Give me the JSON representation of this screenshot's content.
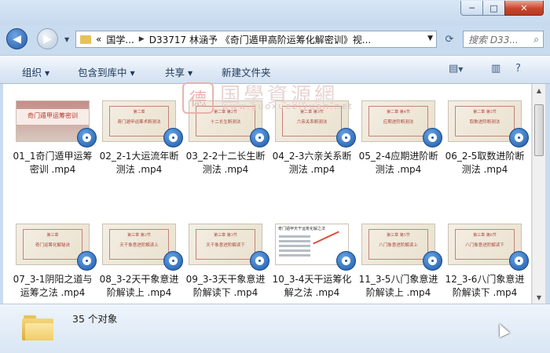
{
  "window": {
    "controls": {
      "minimize": "─",
      "maximize": "□",
      "close": "✕"
    }
  },
  "nav": {
    "back_icon": "arrow-left",
    "forward_icon": "arrow-right",
    "address": {
      "overflow": "«",
      "segments": [
        "国学...",
        "D33717 林涵予 《奇门遁甲高阶运筹化解密训》视..."
      ]
    },
    "search_placeholder": "搜索 D33..."
  },
  "toolbar": {
    "items": [
      "组织",
      "包含到库中",
      "共享",
      "新建文件夹"
    ],
    "accent": "#1e395b"
  },
  "files": [
    {
      "name": "01_1奇门遁甲运筹密训 .mp4",
      "thumb": "cover",
      "t1": "",
      "t2": "奇门遁甲运筹密训"
    },
    {
      "name": "02_2-1大运流年断测法 .mp4",
      "thumb": "chapter",
      "t1": "第二章",
      "t2": "奇门遁甲运筹术断测法"
    },
    {
      "name": "03_2-2十二长生断测法 .mp4",
      "thumb": "chapter",
      "t1": "第二章 第2节",
      "t2": "十二长生断测法"
    },
    {
      "name": "04_2-3六亲关系断测法 .mp4",
      "thumb": "chapter",
      "t1": "第二章 第3节",
      "t2": "六亲关系断测法"
    },
    {
      "name": "05_2-4应期进阶断测法 .mp4",
      "thumb": "chapter",
      "t1": "第二章 第4节",
      "t2": "应期进阶断测法"
    },
    {
      "name": "06_2-5取数进阶断测法 .mp4",
      "thumb": "chapter",
      "t1": "第二章 第5节",
      "t2": "取数进阶断测法"
    },
    {
      "name": "07_3-1阴阳之道与运筹之法 .mp4",
      "thumb": "chapter",
      "t1": "第三章",
      "t2": "奇门运筹化解秘诀"
    },
    {
      "name": "08_3-2天干象意进阶解读上 .mp4",
      "thumb": "chapter",
      "t1": "第三章 第2节",
      "t2": "天干象意进阶解读上"
    },
    {
      "name": "09_3-3天干象意进阶解读下 .mp4",
      "thumb": "chapter",
      "t1": "第三章 第3节",
      "t2": "天干象意进阶解读下"
    },
    {
      "name": "10_3-4天干运筹化解之法 .mp4",
      "thumb": "slide",
      "t1": "奇门遁甲天干运筹化解之法",
      "t2": ""
    },
    {
      "name": "11_3-5八门象意进阶解读上 .mp4",
      "thumb": "chapter",
      "t1": "第三章 第5节",
      "t2": "八门象意进阶解读上"
    },
    {
      "name": "12_3-6八门象意进阶解读下 .mp4",
      "thumb": "chapter",
      "t1": "第三章 第6节",
      "t2": "八门象意进阶解读下"
    }
  ],
  "watermark": {
    "seal": "德",
    "cn": "国學資源網",
    "url": "www.guoxueziyuan.net"
  },
  "status": {
    "count": "35 个对象"
  }
}
